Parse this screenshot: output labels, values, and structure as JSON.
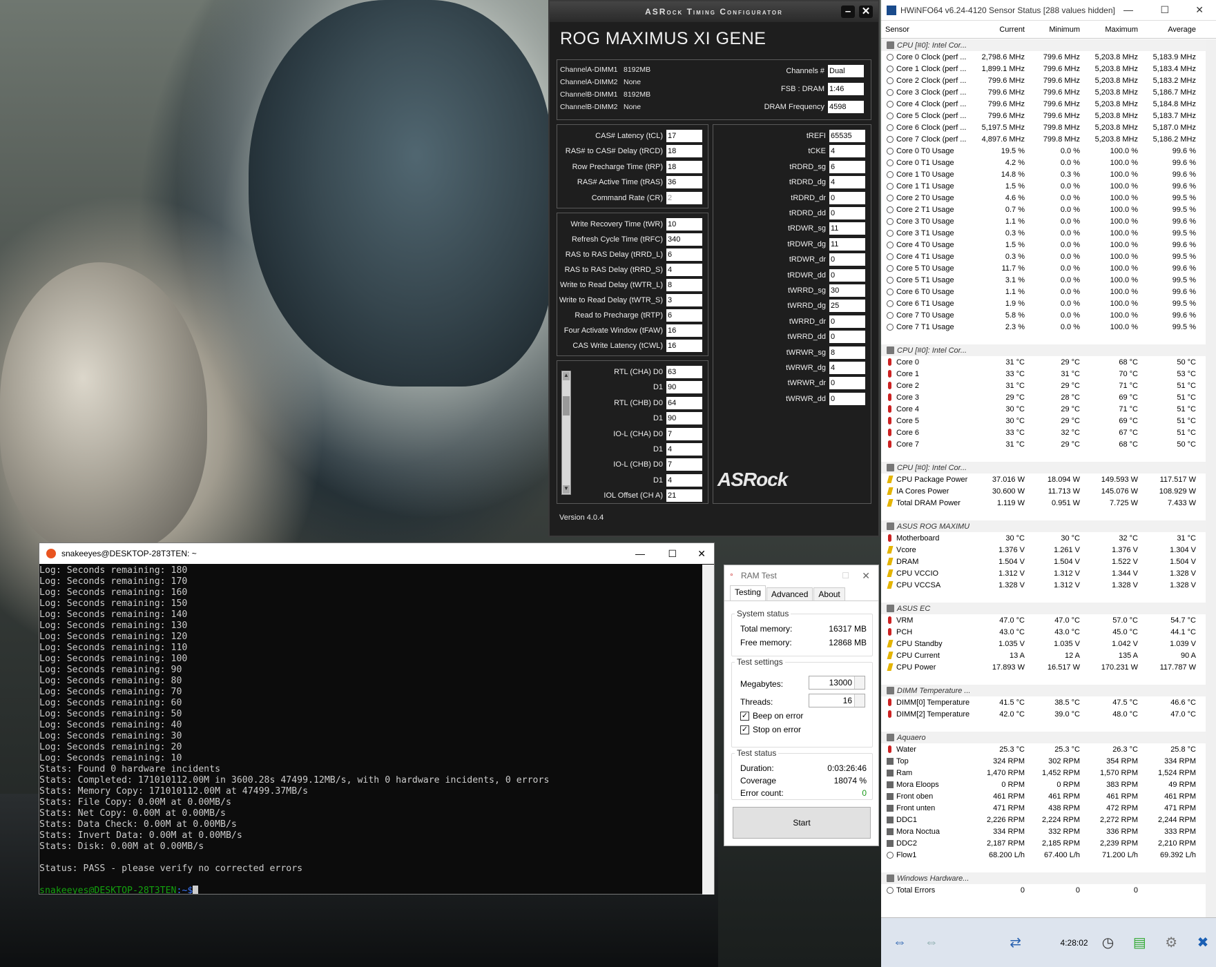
{
  "asrock": {
    "title": "ASRock Timing Configurator",
    "model": "ROG MAXIMUS XI GENE",
    "dimms": [
      {
        "label": "ChannelA-DIMM1",
        "value": "8192MB"
      },
      {
        "label": "ChannelA-DIMM2",
        "value": "None"
      },
      {
        "label": "ChannelB-DIMM1",
        "value": "8192MB"
      },
      {
        "label": "ChannelB-DIMM2",
        "value": "None"
      }
    ],
    "channels_label": "Channels #",
    "channels": "Dual",
    "fsb_label": "FSB : DRAM",
    "fsb": "1:46",
    "freq_label": "DRAM Frequency",
    "freq": "4598",
    "primary": [
      {
        "label": "CAS# Latency (tCL)",
        "value": "17"
      },
      {
        "label": "RAS# to CAS# Delay (tRCD)",
        "value": "18"
      },
      {
        "label": "Row Precharge Time (tRP)",
        "value": "18"
      },
      {
        "label": "RAS# Active Time (tRAS)",
        "value": "36"
      },
      {
        "label": "Command Rate (CR)",
        "value": "2"
      }
    ],
    "secondary": [
      {
        "label": "Write Recovery Time (tWR)",
        "value": "10"
      },
      {
        "label": "Refresh Cycle Time (tRFC)",
        "value": "340"
      },
      {
        "label": "RAS to RAS Delay (tRRD_L)",
        "value": "6"
      },
      {
        "label": "RAS to RAS Delay (tRRD_S)",
        "value": "4"
      },
      {
        "label": "Write to Read Delay (tWTR_L)",
        "value": "8"
      },
      {
        "label": "Write to Read Delay (tWTR_S)",
        "value": "3"
      },
      {
        "label": "Read to Precharge (tRTP)",
        "value": "6"
      },
      {
        "label": "Four Activate Window (tFAW)",
        "value": "16"
      },
      {
        "label": "CAS Write Latency (tCWL)",
        "value": "16"
      }
    ],
    "rtl": [
      {
        "label": "RTL (CHA) D0",
        "value": "63"
      },
      {
        "label": "D1",
        "value": "90"
      },
      {
        "label": "RTL (CHB) D0",
        "value": "64"
      },
      {
        "label": "D1",
        "value": "90"
      },
      {
        "label": "IO-L (CHA) D0",
        "value": "7"
      },
      {
        "label": "D1",
        "value": "4"
      },
      {
        "label": "IO-L (CHB) D0",
        "value": "7"
      },
      {
        "label": "D1",
        "value": "4"
      },
      {
        "label": "IOL Offset (CH A)",
        "value": "21"
      }
    ],
    "tertiary": [
      {
        "label": "tREFI",
        "value": "65535"
      },
      {
        "label": "tCKE",
        "value": "4"
      },
      {
        "label": "tRDRD_sg",
        "value": "6"
      },
      {
        "label": "tRDRD_dg",
        "value": "4"
      },
      {
        "label": "tRDRD_dr",
        "value": "0"
      },
      {
        "label": "tRDRD_dd",
        "value": "0"
      },
      {
        "label": "tRDWR_sg",
        "value": "11"
      },
      {
        "label": "tRDWR_dg",
        "value": "11"
      },
      {
        "label": "tRDWR_dr",
        "value": "0"
      },
      {
        "label": "tRDWR_dd",
        "value": "0"
      },
      {
        "label": "tWRRD_sg",
        "value": "30"
      },
      {
        "label": "tWRRD_dg",
        "value": "25"
      },
      {
        "label": "tWRRD_dr",
        "value": "0"
      },
      {
        "label": "tWRRD_dd",
        "value": "0"
      },
      {
        "label": "tWRWR_sg",
        "value": "8"
      },
      {
        "label": "tWRWR_dg",
        "value": "4"
      },
      {
        "label": "tWRWR_dr",
        "value": "0"
      },
      {
        "label": "tWRWR_dd",
        "value": "0"
      }
    ],
    "logo": "ASRock",
    "version": "Version 4.0.4"
  },
  "hwinfo": {
    "title": "HWiNFO64 v6.24-4120 Sensor Status [288 values hidden]",
    "columns": [
      "Sensor",
      "Current",
      "Minimum",
      "Maximum",
      "Average"
    ],
    "time": "4:28:02",
    "rows": [
      {
        "g": "CPU [#0]: Intel Cor..."
      },
      {
        "i": "clock",
        "n": "Core 0 Clock (perf ...",
        "v": [
          "2,798.6 MHz",
          "799.6 MHz",
          "5,203.8 MHz",
          "5,183.9 MHz"
        ]
      },
      {
        "i": "clock",
        "n": "Core 1 Clock (perf ...",
        "v": [
          "1,899.1 MHz",
          "799.6 MHz",
          "5,203.8 MHz",
          "5,183.4 MHz"
        ]
      },
      {
        "i": "clock",
        "n": "Core 2 Clock (perf ...",
        "v": [
          "799.6 MHz",
          "799.6 MHz",
          "5,203.8 MHz",
          "5,183.2 MHz"
        ]
      },
      {
        "i": "clock",
        "n": "Core 3 Clock (perf ...",
        "v": [
          "799.6 MHz",
          "799.6 MHz",
          "5,203.8 MHz",
          "5,186.7 MHz"
        ]
      },
      {
        "i": "clock",
        "n": "Core 4 Clock (perf ...",
        "v": [
          "799.6 MHz",
          "799.6 MHz",
          "5,203.8 MHz",
          "5,184.8 MHz"
        ]
      },
      {
        "i": "clock",
        "n": "Core 5 Clock (perf ...",
        "v": [
          "799.6 MHz",
          "799.6 MHz",
          "5,203.8 MHz",
          "5,183.7 MHz"
        ]
      },
      {
        "i": "clock",
        "n": "Core 6 Clock (perf ...",
        "v": [
          "5,197.5 MHz",
          "799.8 MHz",
          "5,203.8 MHz",
          "5,187.0 MHz"
        ]
      },
      {
        "i": "clock",
        "n": "Core 7 Clock (perf ...",
        "v": [
          "4,897.6 MHz",
          "799.8 MHz",
          "5,203.8 MHz",
          "5,186.2 MHz"
        ]
      },
      {
        "i": "clock",
        "n": "Core 0 T0 Usage",
        "v": [
          "19.5 %",
          "0.0 %",
          "100.0 %",
          "99.6 %"
        ]
      },
      {
        "i": "clock",
        "n": "Core 0 T1 Usage",
        "v": [
          "4.2 %",
          "0.0 %",
          "100.0 %",
          "99.6 %"
        ]
      },
      {
        "i": "clock",
        "n": "Core 1 T0 Usage",
        "v": [
          "14.8 %",
          "0.3 %",
          "100.0 %",
          "99.6 %"
        ]
      },
      {
        "i": "clock",
        "n": "Core 1 T1 Usage",
        "v": [
          "1.5 %",
          "0.0 %",
          "100.0 %",
          "99.6 %"
        ]
      },
      {
        "i": "clock",
        "n": "Core 2 T0 Usage",
        "v": [
          "4.6 %",
          "0.0 %",
          "100.0 %",
          "99.5 %"
        ]
      },
      {
        "i": "clock",
        "n": "Core 2 T1 Usage",
        "v": [
          "0.7 %",
          "0.0 %",
          "100.0 %",
          "99.5 %"
        ]
      },
      {
        "i": "clock",
        "n": "Core 3 T0 Usage",
        "v": [
          "1.1 %",
          "0.0 %",
          "100.0 %",
          "99.6 %"
        ]
      },
      {
        "i": "clock",
        "n": "Core 3 T1 Usage",
        "v": [
          "0.3 %",
          "0.0 %",
          "100.0 %",
          "99.5 %"
        ]
      },
      {
        "i": "clock",
        "n": "Core 4 T0 Usage",
        "v": [
          "1.5 %",
          "0.0 %",
          "100.0 %",
          "99.6 %"
        ]
      },
      {
        "i": "clock",
        "n": "Core 4 T1 Usage",
        "v": [
          "0.3 %",
          "0.0 %",
          "100.0 %",
          "99.5 %"
        ]
      },
      {
        "i": "clock",
        "n": "Core 5 T0 Usage",
        "v": [
          "11.7 %",
          "0.0 %",
          "100.0 %",
          "99.6 %"
        ]
      },
      {
        "i": "clock",
        "n": "Core 5 T1 Usage",
        "v": [
          "3.1 %",
          "0.0 %",
          "100.0 %",
          "99.5 %"
        ]
      },
      {
        "i": "clock",
        "n": "Core 6 T0 Usage",
        "v": [
          "1.1 %",
          "0.0 %",
          "100.0 %",
          "99.6 %"
        ]
      },
      {
        "i": "clock",
        "n": "Core 6 T1 Usage",
        "v": [
          "1.9 %",
          "0.0 %",
          "100.0 %",
          "99.5 %"
        ]
      },
      {
        "i": "clock",
        "n": "Core 7 T0 Usage",
        "v": [
          "5.8 %",
          "0.0 %",
          "100.0 %",
          "99.6 %"
        ]
      },
      {
        "i": "clock",
        "n": "Core 7 T1 Usage",
        "v": [
          "2.3 %",
          "0.0 %",
          "100.0 %",
          "99.5 %"
        ]
      },
      {
        "gap": true
      },
      {
        "g": "CPU [#0]: Intel Cor..."
      },
      {
        "i": "temp",
        "n": "Core 0",
        "v": [
          "31 °C",
          "29 °C",
          "68 °C",
          "50 °C"
        ]
      },
      {
        "i": "temp",
        "n": "Core 1",
        "v": [
          "33 °C",
          "31 °C",
          "70 °C",
          "53 °C"
        ]
      },
      {
        "i": "temp",
        "n": "Core 2",
        "v": [
          "31 °C",
          "29 °C",
          "71 °C",
          "51 °C"
        ]
      },
      {
        "i": "temp",
        "n": "Core 3",
        "v": [
          "29 °C",
          "28 °C",
          "69 °C",
          "51 °C"
        ]
      },
      {
        "i": "temp",
        "n": "Core 4",
        "v": [
          "30 °C",
          "29 °C",
          "71 °C",
          "51 °C"
        ]
      },
      {
        "i": "temp",
        "n": "Core 5",
        "v": [
          "30 °C",
          "29 °C",
          "69 °C",
          "51 °C"
        ]
      },
      {
        "i": "temp",
        "n": "Core 6",
        "v": [
          "33 °C",
          "32 °C",
          "67 °C",
          "51 °C"
        ]
      },
      {
        "i": "temp",
        "n": "Core 7",
        "v": [
          "31 °C",
          "29 °C",
          "68 °C",
          "50 °C"
        ]
      },
      {
        "gap": true
      },
      {
        "g": "CPU [#0]: Intel Cor..."
      },
      {
        "i": "power",
        "n": "CPU Package Power",
        "v": [
          "37.016 W",
          "18.094 W",
          "149.593 W",
          "117.517 W"
        ]
      },
      {
        "i": "power",
        "n": "IA Cores Power",
        "v": [
          "30.600 W",
          "11.713 W",
          "145.076 W",
          "108.929 W"
        ]
      },
      {
        "i": "power",
        "n": "Total DRAM Power",
        "v": [
          "1.119 W",
          "0.951 W",
          "7.725 W",
          "7.433 W"
        ]
      },
      {
        "gap": true
      },
      {
        "g": "ASUS ROG MAXIMU..."
      },
      {
        "i": "temp",
        "n": "Motherboard",
        "v": [
          "30 °C",
          "30 °C",
          "32 °C",
          "31 °C"
        ]
      },
      {
        "i": "power",
        "n": "Vcore",
        "v": [
          "1.376 V",
          "1.261 V",
          "1.376 V",
          "1.304 V"
        ]
      },
      {
        "i": "power",
        "n": "DRAM",
        "v": [
          "1.504 V",
          "1.504 V",
          "1.522 V",
          "1.504 V"
        ]
      },
      {
        "i": "power",
        "n": "CPU VCCIO",
        "v": [
          "1.312 V",
          "1.312 V",
          "1.344 V",
          "1.328 V"
        ]
      },
      {
        "i": "power",
        "n": "CPU VCCSA",
        "v": [
          "1.328 V",
          "1.312 V",
          "1.328 V",
          "1.328 V"
        ]
      },
      {
        "gap": true
      },
      {
        "g": "ASUS EC"
      },
      {
        "i": "temp",
        "n": "VRM",
        "v": [
          "47.0 °C",
          "47.0 °C",
          "57.0 °C",
          "54.7 °C"
        ]
      },
      {
        "i": "temp",
        "n": "PCH",
        "v": [
          "43.0 °C",
          "43.0 °C",
          "45.0 °C",
          "44.1 °C"
        ]
      },
      {
        "i": "power",
        "n": "CPU Standby",
        "v": [
          "1.035 V",
          "1.035 V",
          "1.042 V",
          "1.039 V"
        ]
      },
      {
        "i": "power",
        "n": "CPU Current",
        "v": [
          "13 A",
          "12 A",
          "135 A",
          "90 A"
        ]
      },
      {
        "i": "power",
        "n": "CPU Power",
        "v": [
          "17.893 W",
          "16.517 W",
          "170.231 W",
          "117.787 W"
        ]
      },
      {
        "gap": true
      },
      {
        "g": "DIMM Temperature ..."
      },
      {
        "i": "temp",
        "n": "DIMM[0] Temperature",
        "v": [
          "41.5 °C",
          "38.5 °C",
          "47.5 °C",
          "46.6 °C"
        ]
      },
      {
        "i": "temp",
        "n": "DIMM[2] Temperature",
        "v": [
          "42.0 °C",
          "39.0 °C",
          "48.0 °C",
          "47.0 °C"
        ]
      },
      {
        "gap": true
      },
      {
        "g": "Aquaero"
      },
      {
        "i": "temp",
        "n": "Water",
        "v": [
          "25.3 °C",
          "25.3 °C",
          "26.3 °C",
          "25.8 °C"
        ]
      },
      {
        "i": "fan",
        "n": "Top",
        "v": [
          "324 RPM",
          "302 RPM",
          "354 RPM",
          "334 RPM"
        ]
      },
      {
        "i": "fan",
        "n": "Ram",
        "v": [
          "1,470 RPM",
          "1,452 RPM",
          "1,570 RPM",
          "1,524 RPM"
        ]
      },
      {
        "i": "fan",
        "n": "Mora Eloops",
        "v": [
          "0 RPM",
          "0 RPM",
          "383 RPM",
          "49 RPM"
        ]
      },
      {
        "i": "fan",
        "n": "Front oben",
        "v": [
          "461 RPM",
          "461 RPM",
          "461 RPM",
          "461 RPM"
        ]
      },
      {
        "i": "fan",
        "n": "Front unten",
        "v": [
          "471 RPM",
          "438 RPM",
          "472 RPM",
          "471 RPM"
        ]
      },
      {
        "i": "fan",
        "n": "DDC1",
        "v": [
          "2,226 RPM",
          "2,224 RPM",
          "2,272 RPM",
          "2,244 RPM"
        ]
      },
      {
        "i": "fan",
        "n": "Mora Noctua",
        "v": [
          "334 RPM",
          "332 RPM",
          "336 RPM",
          "333 RPM"
        ]
      },
      {
        "i": "fan",
        "n": "DDC2",
        "v": [
          "2,187 RPM",
          "2,185 RPM",
          "2,239 RPM",
          "2,210 RPM"
        ]
      },
      {
        "i": "clock",
        "n": "Flow1",
        "v": [
          "68.200 L/h",
          "67.400 L/h",
          "71.200 L/h",
          "69.392 L/h"
        ]
      },
      {
        "gap": true
      },
      {
        "g": "Windows Hardware..."
      },
      {
        "i": "clock",
        "n": "Total Errors",
        "v": [
          "0",
          "0",
          "0",
          ""
        ]
      }
    ]
  },
  "terminal": {
    "title": "snakeeyes@DESKTOP-28T3TEN: ~",
    "lines": [
      "Log: Seconds remaining: 180",
      "Log: Seconds remaining: 170",
      "Log: Seconds remaining: 160",
      "Log: Seconds remaining: 150",
      "Log: Seconds remaining: 140",
      "Log: Seconds remaining: 130",
      "Log: Seconds remaining: 120",
      "Log: Seconds remaining: 110",
      "Log: Seconds remaining: 100",
      "Log: Seconds remaining: 90",
      "Log: Seconds remaining: 80",
      "Log: Seconds remaining: 70",
      "Log: Seconds remaining: 60",
      "Log: Seconds remaining: 50",
      "Log: Seconds remaining: 40",
      "Log: Seconds remaining: 30",
      "Log: Seconds remaining: 20",
      "Log: Seconds remaining: 10",
      "Stats: Found 0 hardware incidents",
      "Stats: Completed: 171010112.00M in 3600.28s 47499.12MB/s, with 0 hardware incidents, 0 errors",
      "Stats: Memory Copy: 171010112.00M at 47499.37MB/s",
      "Stats: File Copy: 0.00M at 0.00MB/s",
      "Stats: Net Copy: 0.00M at 0.00MB/s",
      "Stats: Data Check: 0.00M at 0.00MB/s",
      "Stats: Invert Data: 0.00M at 0.00MB/s",
      "Stats: Disk: 0.00M at 0.00MB/s",
      "",
      "Status: PASS - please verify no corrected errors",
      ""
    ],
    "prompt_user": "snakeeyes@DESKTOP-28T3TEN",
    "prompt_path": ":~$"
  },
  "ramtest": {
    "title": "RAM Test",
    "tabs": [
      "Testing",
      "Advanced",
      "About"
    ],
    "system_status": "System status",
    "total_label": "Total memory:",
    "total": "16317 MB",
    "free_label": "Free memory:",
    "free": "12868 MB",
    "settings": "Test settings",
    "mb_label": "Megabytes:",
    "mb": "13000",
    "threads_label": "Threads:",
    "threads": "16",
    "beep": "Beep on error",
    "stop": "Stop on error",
    "test_status": "Test status",
    "duration_label": "Duration:",
    "duration": "0:03:26:46",
    "coverage_label": "Coverage",
    "coverage": "18074 %",
    "errors_label": "Error count:",
    "errors": "0",
    "start": "Start"
  }
}
